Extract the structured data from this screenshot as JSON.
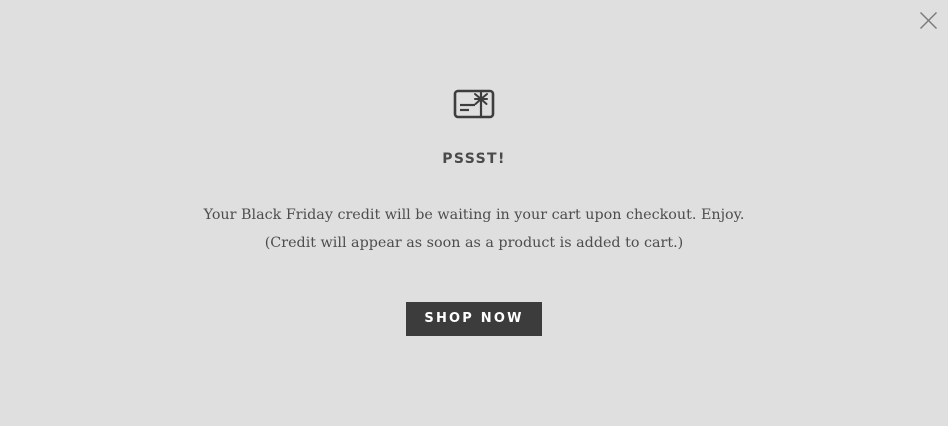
{
  "modal": {
    "close_icon": "close-icon",
    "badge_icon": "gift-card-icon",
    "title": "PSSST!",
    "message_line1": "Your Black Friday credit will be waiting in your cart upon checkout. Enjoy.",
    "message_line2": "(Credit will appear as soon as a product is added to cart.)",
    "cta_label": "SHOP NOW"
  },
  "colors": {
    "background": "#dfdfdf",
    "button_background": "#3c3c3c",
    "button_text": "#ffffff",
    "text": "#4d4d4d"
  }
}
